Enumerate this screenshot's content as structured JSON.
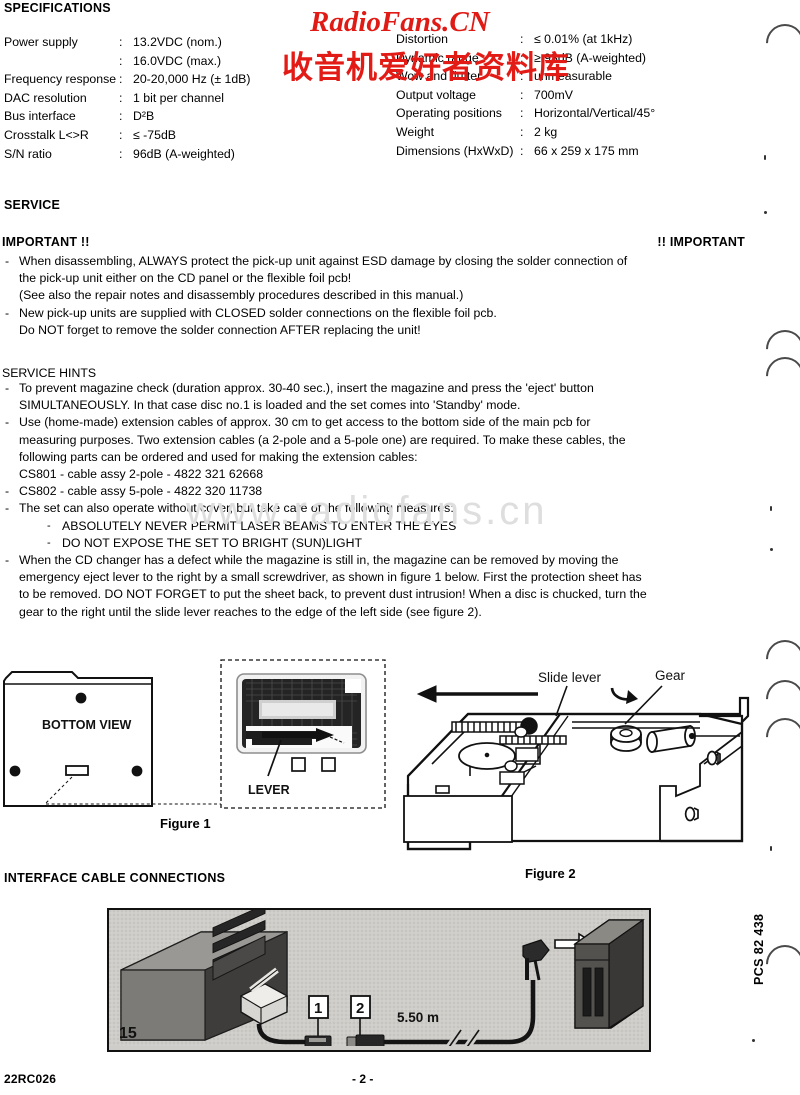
{
  "specifications": {
    "heading": "SPECIFICATIONS",
    "left_rows": [
      {
        "label": "Power supply",
        "colon": ":",
        "value": "13.2VDC (nom.)"
      },
      {
        "label": "",
        "colon": ":",
        "value": "16.0VDC (max.)"
      },
      {
        "label": "Frequency response",
        "colon": ":",
        "value": "20-20,000 Hz (± 1dB)"
      },
      {
        "label": "DAC resolution",
        "colon": ":",
        "value": "1 bit per channel"
      },
      {
        "label": "Bus interface",
        "colon": ":",
        "value": "D²B"
      },
      {
        "label": "Crosstalk L<>R",
        "colon": ":",
        "value": "≤ -75dB"
      },
      {
        "label": "S/N ratio",
        "colon": ":",
        "value": "96dB (A-weighted)"
      }
    ],
    "right_rows": [
      {
        "label": "Distortion",
        "colon": ":",
        "value": "≤ 0.01% (at 1kHz)"
      },
      {
        "label": "Dynamic range",
        "colon": ":",
        "value": "≥ 93dB (A-weighted)"
      },
      {
        "label": "Wow and flutter",
        "colon": ":",
        "value": "unmeasurable"
      },
      {
        "label": "Output voltage",
        "colon": ":",
        "value": "700mV"
      },
      {
        "label": "Operating positions",
        "colon": ":",
        "value": "Horizontal/Vertical/45°"
      },
      {
        "label": "Weight",
        "colon": ":",
        "value": "2 kg"
      },
      {
        "label": "Dimensions (HxWxD)",
        "colon": ":",
        "value": "66 x 259 x 175 mm"
      }
    ]
  },
  "service": {
    "heading": "SERVICE",
    "important_left": "IMPORTANT !!",
    "important_right": "!! IMPORTANT",
    "items": [
      "When disassembling, ALWAYS protect the pick-up unit against ESD damage by closing the solder connection of",
      "the pick-up unit either on the CD panel or the flexible foil pcb!",
      "(See also the repair notes and disassembly procedures described in this manual.)",
      "New pick-up units are supplied with CLOSED solder connections on the flexible foil pcb.",
      "Do NOT forget to remove the solder connection AFTER replacing the unit!"
    ]
  },
  "service_hints": {
    "heading": "SERVICE HINTS",
    "hint1_line1": "To prevent magazine check (duration approx. 30-40 sec.), insert the magazine and press the 'eject' button",
    "hint1_line2": "SIMULTANEOUSLY. In that case disc no.1 is loaded and the set comes into 'Standby' mode.",
    "hint2_line1": "Use (home-made) extension cables of approx. 30 cm to get access to the bottom side of the main pcb for",
    "hint2_line2": "measuring purposes. Two extension cables (a 2-pole and a 5-pole one) are required. To make these cables, the",
    "hint2_line3": "following parts can be ordered and used for making the extension cables:",
    "hint2_line4": "CS801 - cable assy 2-pole - 4822 321 62668",
    "hint3": "CS802 - cable assy 5-pole - 4822 320 11738",
    "hint4": "The set can also operate without cover, but take care of the following measures:",
    "hint4_sub1": "ABSOLUTELY NEVER PERMIT LASER BEAMS TO ENTER THE EYES",
    "hint4_sub2": "DO NOT EXPOSE THE SET TO BRIGHT (SUN)LIGHT",
    "hint5_line1": "When the CD changer has a defect while the magazine is still in, the magazine can be removed by moving the",
    "hint5_line2": "emergency eject lever to the right by a small screwdriver, as shown in figure 1 below. First the protection sheet has",
    "hint5_line3": "to be removed. DO NOT FORGET to put the sheet back, to prevent dust intrusion! When a disc is chucked, turn the",
    "hint5_line4": "gear to the right until the slide lever reaches to the edge of the left side (see figure 2)."
  },
  "figure1": {
    "caption": "Figure 1",
    "bottom_view_label": "BOTTOM VIEW",
    "lever_label": "LEVER"
  },
  "figure2": {
    "caption": "Figure 2",
    "slide_lever_label": "Slide lever",
    "gear_label": "Gear"
  },
  "interface": {
    "heading": "INTERFACE CABLE CONNECTIONS",
    "callout_1": "1",
    "callout_2": "2",
    "cable_length": "5.50 m",
    "corner_number": "15"
  },
  "footer": {
    "doc_code": "22RC026",
    "page_number": "- 2 -",
    "pcs_code": "PCS 82 438"
  },
  "watermarks": {
    "red_latin": "RadioFans.CN",
    "red_cjk": "收音机爱好者资料库",
    "gray_url": "www.radiofans.cn"
  }
}
